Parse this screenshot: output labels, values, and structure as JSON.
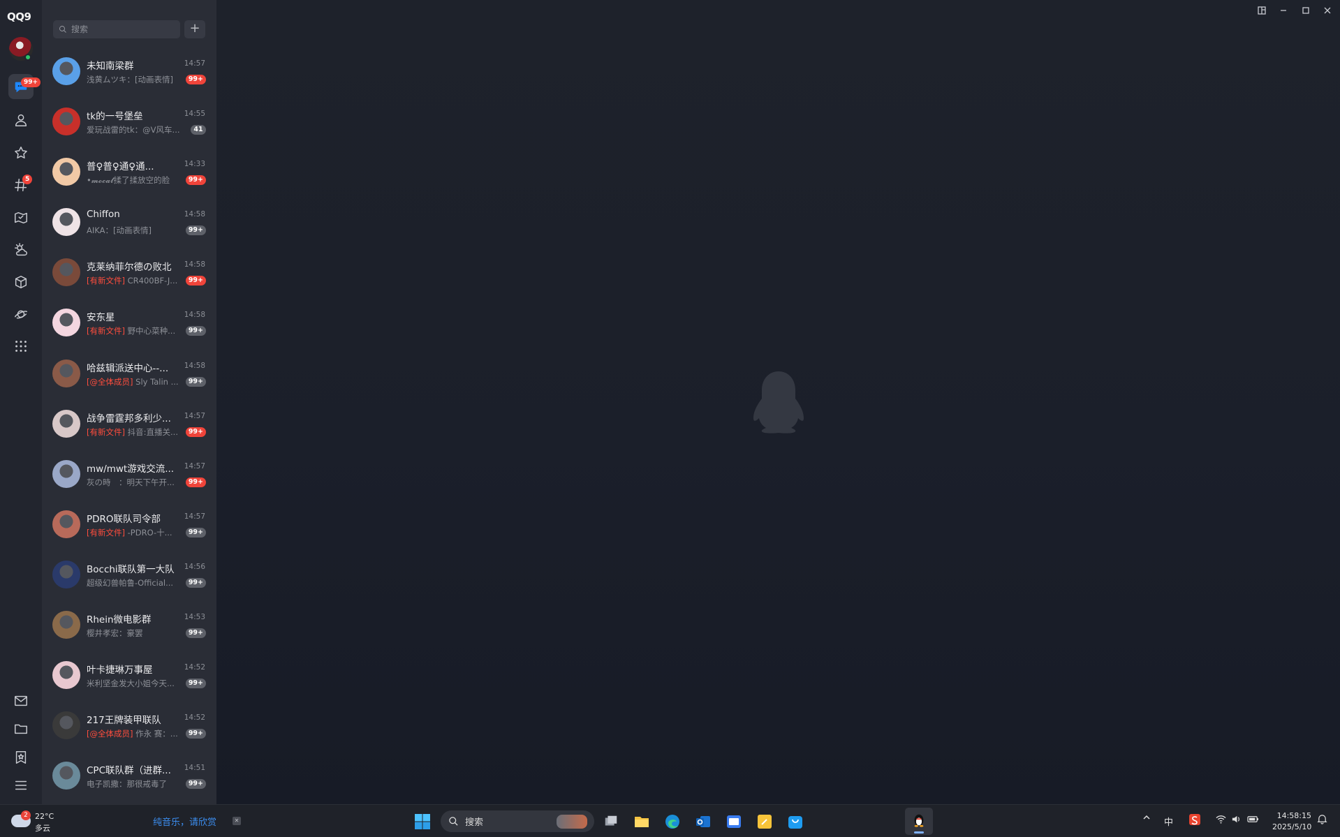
{
  "app": {
    "logo": "QQ9"
  },
  "rail": {
    "chat_badge": "99+",
    "channel_badge": "5"
  },
  "search": {
    "placeholder": "搜索",
    "add_label": "+"
  },
  "conversations": [
    {
      "name": "未知南梁群",
      "time": "14:57",
      "tag": "",
      "preview": "浅黄ムツキ：[动画表情]",
      "badge": "99+",
      "badge_color": "red",
      "avatar_color": "#5aa0e8"
    },
    {
      "name": "tk的一号堡垒",
      "time": "14:55",
      "tag": "",
      "preview": "爱玩战雷的tk：@V风车...",
      "badge": "41",
      "badge_color": "grey",
      "avatar_color": "#c8302a"
    },
    {
      "name": "普♀普♀通♀通...",
      "time": "14:33",
      "tag": "",
      "preview": "•𝓶𝓸𝓬𝓪𝓽揉了揉放空的脸",
      "badge": "99+",
      "badge_color": "red",
      "avatar_color": "#f1c9a6"
    },
    {
      "name": "Chiffon",
      "time": "14:58",
      "tag": "",
      "preview": "AIKA：[动画表情]",
      "badge": "99+",
      "badge_color": "grey",
      "avatar_color": "#efe3e6"
    },
    {
      "name": "克莱纳菲尔德の败北",
      "time": "14:58",
      "tag": "[有新文件]",
      "preview": " CR400BF-J...",
      "badge": "99+",
      "badge_color": "red",
      "avatar_color": "#7a4a3a"
    },
    {
      "name": "安东星",
      "time": "14:58",
      "tag": "[有新文件]",
      "preview": " 野中心菜种...",
      "badge": "99+",
      "badge_color": "grey",
      "avatar_color": "#f4d6e0"
    },
    {
      "name": "哈兹辑派送中心--...",
      "time": "14:58",
      "tag": "[@全体成员]",
      "preview": " Sly Talin ...",
      "badge": "99+",
      "badge_color": "grey",
      "avatar_color": "#8a5a48"
    },
    {
      "name": "战争雷霆邦多利少...",
      "time": "14:57",
      "tag": "[有新文件]",
      "preview": " 抖音:直播关...",
      "badge": "99+",
      "badge_color": "red",
      "avatar_color": "#d8c8c8"
    },
    {
      "name": "mw/mwt游戏交流...",
      "time": "14:57",
      "tag": "",
      "preview": "灰の時　：明天下午开...",
      "badge": "99+",
      "badge_color": "red",
      "avatar_color": "#9aa8c8"
    },
    {
      "name": "PDRO联队司令部",
      "time": "14:57",
      "tag": "[有新文件]",
      "preview": " -PDRO-十...",
      "badge": "99+",
      "badge_color": "grey",
      "avatar_color": "#b86a5a"
    },
    {
      "name": "Bocchi联队第一大队",
      "time": "14:56",
      "tag": "",
      "preview": "超级幻兽帕鲁-Official...",
      "badge": "99+",
      "badge_color": "grey",
      "avatar_color": "#2a3a6a"
    },
    {
      "name": "Rhein微电影群",
      "time": "14:53",
      "tag": "",
      "preview": "樱井孝宏：豪罢",
      "badge": "99+",
      "badge_color": "grey",
      "avatar_color": "#8a6a4a"
    },
    {
      "name": "叶卡捷琳万事屋",
      "time": "14:52",
      "tag": "",
      "preview": "米利坚金发大小姐今天...",
      "badge": "99+",
      "badge_color": "grey",
      "avatar_color": "#e8c8d0"
    },
    {
      "name": "217王牌装甲联队",
      "time": "14:52",
      "tag": "[@全体成员]",
      "preview": " 作永 赛：...",
      "badge": "99+",
      "badge_color": "grey",
      "avatar_color": "#3a3a3a"
    },
    {
      "name": "CPC联队群（进群...",
      "time": "14:51",
      "tag": "",
      "preview": "电子凯撒：那很戒毒了",
      "badge": "99+",
      "badge_color": "grey",
      "avatar_color": "#6a8a9a"
    }
  ],
  "taskbar": {
    "weather_badge": "2",
    "weather_temp": "22°C",
    "weather_cond": "多云",
    "music_text": "纯音乐，请欣赏",
    "search_label": "搜索",
    "ime": "中",
    "time": "14:58:15",
    "date": "2025/5/10"
  },
  "colors": {
    "accent": "#1e88ff",
    "badge_red": "#f0443a",
    "badge_grey": "#5e6169",
    "tag_red": "#ff4d3d"
  }
}
